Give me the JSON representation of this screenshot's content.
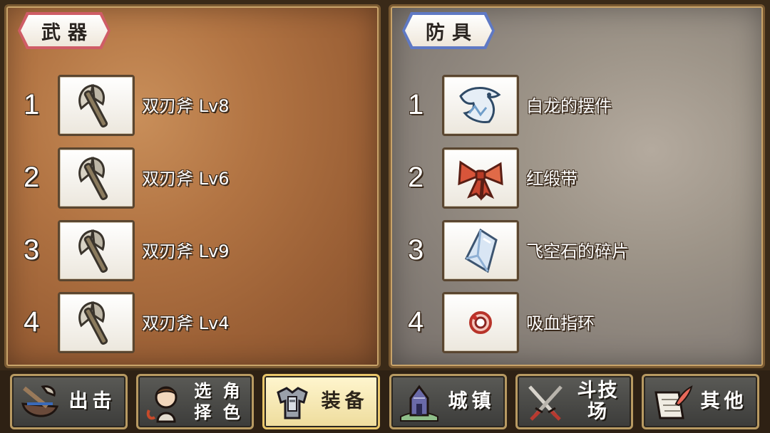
{
  "weapons": {
    "title": "武器",
    "items": [
      {
        "index": "1",
        "name": "双刃斧 Lv8",
        "icon": "double-axe-icon"
      },
      {
        "index": "2",
        "name": "双刃斧 Lv6",
        "icon": "double-axe-icon"
      },
      {
        "index": "3",
        "name": "双刃斧 Lv9",
        "icon": "double-axe-icon"
      },
      {
        "index": "4",
        "name": "双刃斧 Lv4",
        "icon": "double-axe-icon"
      }
    ]
  },
  "armor": {
    "title": "防具",
    "items": [
      {
        "index": "1",
        "name": "白龙的摆件",
        "icon": "white-dragon-ornament-icon"
      },
      {
        "index": "2",
        "name": "红缎带",
        "icon": "red-ribbon-icon"
      },
      {
        "index": "3",
        "name": "飞空石的碎片",
        "icon": "crystal-shard-icon"
      },
      {
        "index": "4",
        "name": "吸血指环",
        "icon": "vampire-ring-icon"
      }
    ]
  },
  "nav": [
    {
      "label": "出击",
      "icon": "sortie-icon",
      "active": false
    },
    {
      "label": "选择",
      "label2": "角色",
      "icon": "character-select-icon",
      "active": false
    },
    {
      "label": "装备",
      "icon": "armor-equip-icon",
      "active": true
    },
    {
      "label": "城镇",
      "icon": "town-icon",
      "active": false
    },
    {
      "label": "斗技场",
      "icon": "arena-swords-icon",
      "active": false
    },
    {
      "label": "其他",
      "icon": "scroll-quill-icon",
      "active": false
    }
  ],
  "colors": {
    "weapons_bg": "#a86a3c",
    "armor_bg": "#928a82",
    "weapons_tab_border": "#cf5d66",
    "armor_tab_border": "#5f79c4",
    "active_nav": "#f4e4a8"
  }
}
